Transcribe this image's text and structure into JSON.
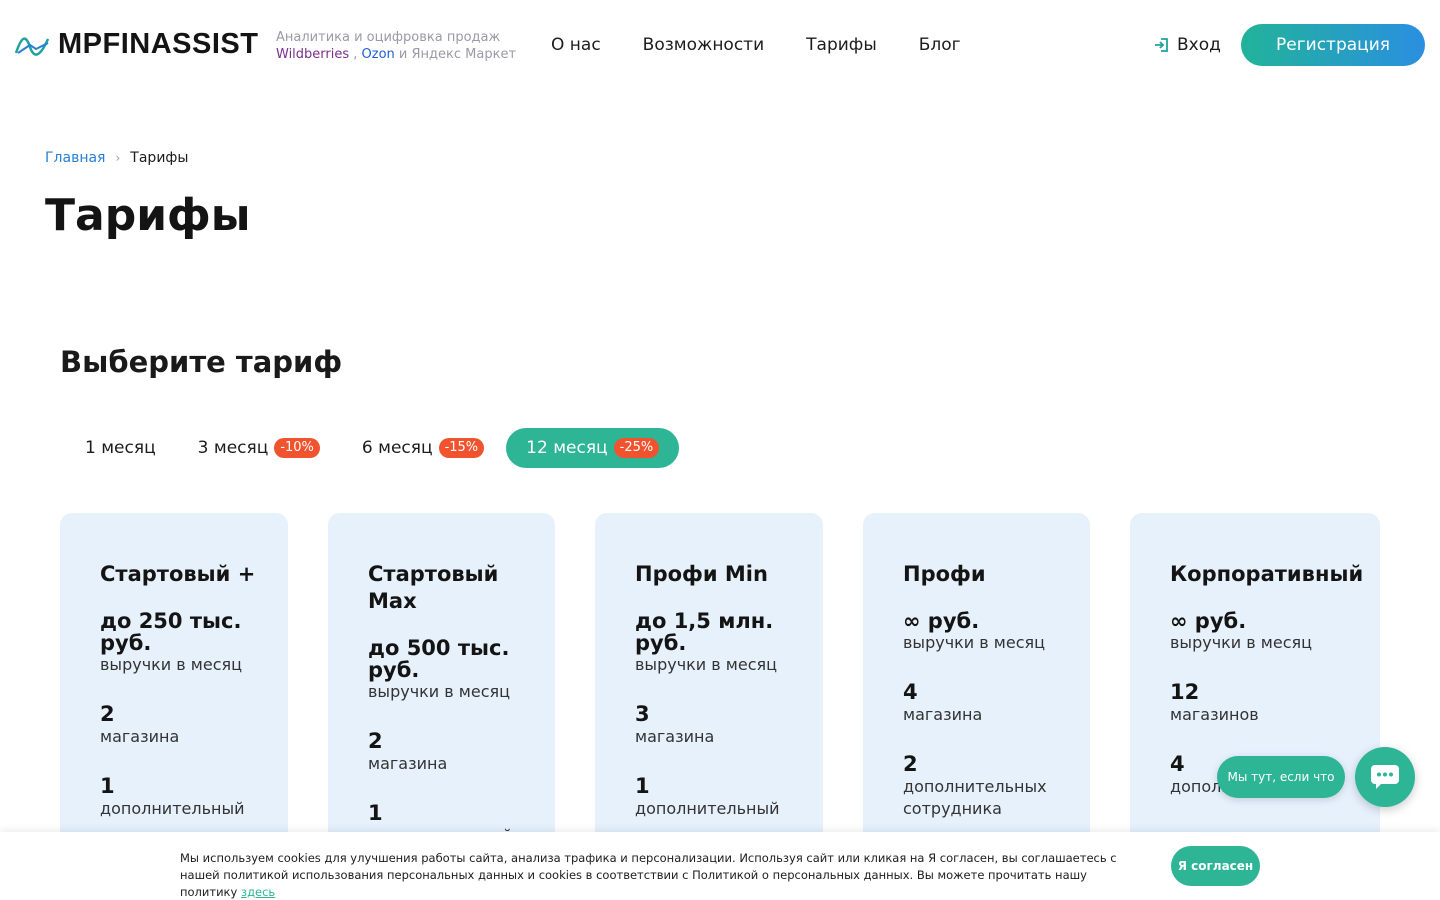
{
  "header": {
    "logo_text": "MPFINASSIST",
    "tagline_line1": "Аналитика и оцифровка продаж",
    "tagline_wb": "Wildberries",
    "tagline_sep": " , ",
    "tagline_ozon": "Ozon",
    "tagline_rest": " и Яндекс Маркет",
    "nav": [
      "О нас",
      "Возможности",
      "Тарифы",
      "Блог"
    ],
    "login_label": "Вход",
    "register_label": "Регистрация"
  },
  "breadcrumb": {
    "home": "Главная",
    "separator": "›",
    "current": "Тарифы"
  },
  "page_title": "Тарифы",
  "section_title": "Выберите тариф",
  "period_tabs": [
    {
      "label": "1 месяц",
      "badge": ""
    },
    {
      "label": "3 месяц",
      "badge": "-10%"
    },
    {
      "label": "6 месяц",
      "badge": "-15%"
    },
    {
      "label": "12 месяц",
      "badge": "-25%",
      "active": true
    }
  ],
  "plans": [
    {
      "name": "Стартовый +",
      "price": "до 250 тыс. руб.",
      "price_sub": "выручки в месяц",
      "stores": "2",
      "stores_label": "магазина",
      "employees": "1",
      "employees_label": "дополнительный"
    },
    {
      "name": "Стартовый Max",
      "price": "до 500 тыс. руб.",
      "price_sub": "выручки в месяц",
      "stores": "2",
      "stores_label": "магазина",
      "employees": "1",
      "employees_label": "дополнительный"
    },
    {
      "name": "Профи Min",
      "price": "до 1,5 млн. руб.",
      "price_sub": "выручки в месяц",
      "stores": "3",
      "stores_label": "магазина",
      "employees": "1",
      "employees_label": "дополнительный"
    },
    {
      "name": "Профи",
      "price": "∞ руб.",
      "price_sub": "выручки в месяц",
      "stores": "4",
      "stores_label": "магазина",
      "employees": "2",
      "employees_label": "дополнительных сотрудника"
    },
    {
      "name": "Корпоративный",
      "price": "∞ руб.",
      "price_sub": "выручки в месяц",
      "stores": "12",
      "stores_label": "магазинов",
      "employees": "4",
      "employees_label": "дополнительных"
    }
  ],
  "chat": {
    "bubble_text": "Мы тут, если что",
    "icon": "chat-dots-icon"
  },
  "cookie": {
    "text": "Мы используем cookies для улучшения работы сайта, анализа трафика и персонализации. Используя сайт или кликая на Я согласен, вы соглашаетесь с нашей политикой использования персональных данных и cookies в соответствии с Политикой о персональных данных. Вы можете прочитать нашу политику ",
    "link": "здесь",
    "accept_label": "Я согласен"
  },
  "colors": {
    "accent": "#2db596",
    "badge": "#f0532d",
    "card_bg": "#e6f1fc",
    "link": "#2a7fd4"
  }
}
